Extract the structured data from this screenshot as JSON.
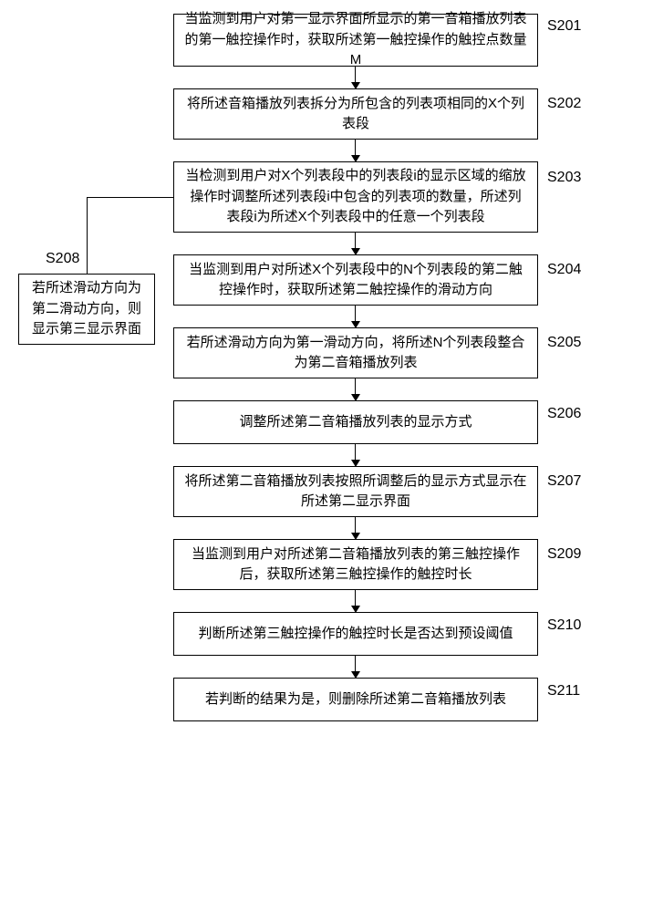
{
  "chart_data": {
    "type": "flowchart",
    "title": "",
    "steps": [
      {
        "id": "S201",
        "text": "当监测到用户对第一显示界面所显示的第一音箱播放列表的第一触控操作时，获取所述第一触控操作的触控点数量M"
      },
      {
        "id": "S202",
        "text": "将所述音箱播放列表拆分为所包含的列表项相同的X个列表段"
      },
      {
        "id": "S203",
        "text": "当检测到用户对X个列表段中的列表段i的显示区域的缩放操作时调整所述列表段i中包含的列表项的数量，所述列表段i为所述X个列表段中的任意一个列表段"
      },
      {
        "id": "S204",
        "text": "当监测到用户对所述X个列表段中的N个列表段的第二触控操作时，获取所述第二触控操作的滑动方向"
      },
      {
        "id": "S205",
        "text": "若所述滑动方向为第一滑动方向，将所述N个列表段整合为第二音箱播放列表"
      },
      {
        "id": "S206",
        "text": "调整所述第二音箱播放列表的显示方式"
      },
      {
        "id": "S207",
        "text": "将所述第二音箱播放列表按照所调整后的显示方式显示在所述第二显示界面"
      },
      {
        "id": "S208",
        "text": "若所述滑动方向为第二滑动方向，则显示第三显示界面"
      },
      {
        "id": "S209",
        "text": "当监测到用户对所述第二音箱播放列表的第三触控操作后，获取所述第三触控操作的触控时长"
      },
      {
        "id": "S210",
        "text": "判断所述第三触控操作的触控时长是否达到预设阈值"
      },
      {
        "id": "S211",
        "text": "若判断的结果为是，则删除所述第二音箱播放列表"
      }
    ],
    "connections": [
      {
        "from": "S201",
        "to": "S202"
      },
      {
        "from": "S202",
        "to": "S203"
      },
      {
        "from": "S203",
        "to": "S204"
      },
      {
        "from": "S204",
        "to": "S205"
      },
      {
        "from": "S205",
        "to": "S206"
      },
      {
        "from": "S206",
        "to": "S207"
      },
      {
        "from": "S207",
        "to": "S209"
      },
      {
        "from": "S209",
        "to": "S210"
      },
      {
        "from": "S210",
        "to": "S211"
      },
      {
        "from": "S204",
        "to": "S208",
        "branch": true
      }
    ]
  },
  "steps": {
    "s201": {
      "label": "S201",
      "text": "当监测到用户对第一显示界面所显示的第一音箱播放列表的第一触控操作时，获取所述第一触控操作的触控点数量M"
    },
    "s202": {
      "label": "S202",
      "text": "将所述音箱播放列表拆分为所包含的列表项相同的X个列表段"
    },
    "s203": {
      "label": "S203",
      "text": "当检测到用户对X个列表段中的列表段i的显示区域的缩放操作时调整所述列表段i中包含的列表项的数量，所述列表段i为所述X个列表段中的任意一个列表段"
    },
    "s204": {
      "label": "S204",
      "text": "当监测到用户对所述X个列表段中的N个列表段的第二触控操作时，获取所述第二触控操作的滑动方向"
    },
    "s205": {
      "label": "S205",
      "text": "若所述滑动方向为第一滑动方向，将所述N个列表段整合为第二音箱播放列表"
    },
    "s206": {
      "label": "S206",
      "text": "调整所述第二音箱播放列表的显示方式"
    },
    "s207": {
      "label": "S207",
      "text": "将所述第二音箱播放列表按照所调整后的显示方式显示在所述第二显示界面"
    },
    "s208": {
      "label": "S208",
      "text": "若所述滑动方向为第二滑动方向，则显示第三显示界面"
    },
    "s209": {
      "label": "S209",
      "text": "当监测到用户对所述第二音箱播放列表的第三触控操作后，获取所述第三触控操作的触控时长"
    },
    "s210": {
      "label": "S210",
      "text": "判断所述第三触控操作的触控时长是否达到预设阈值"
    },
    "s211": {
      "label": "S211",
      "text": "若判断的结果为是，则删除所述第二音箱播放列表"
    }
  }
}
